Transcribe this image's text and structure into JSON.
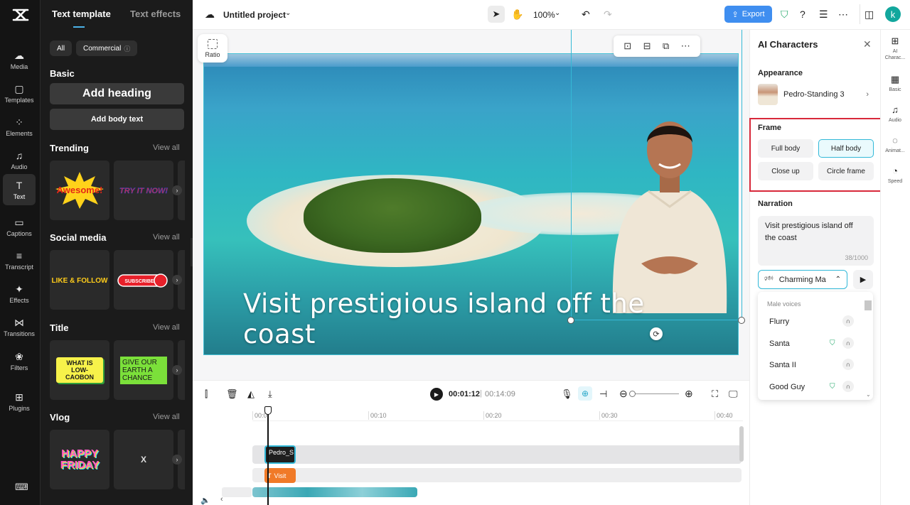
{
  "left_rail": {
    "logo": "CapCut",
    "items": [
      {
        "label": "Media",
        "icon": "media-icon",
        "glyph": "☁"
      },
      {
        "label": "Templates",
        "icon": "templates-icon",
        "glyph": "▢"
      },
      {
        "label": "Elements",
        "icon": "elements-icon",
        "glyph": "⁘"
      },
      {
        "label": "Audio",
        "icon": "audio-icon",
        "glyph": "♫"
      },
      {
        "label": "Text",
        "icon": "text-icon",
        "glyph": "T"
      },
      {
        "label": "Captions",
        "icon": "captions-icon",
        "glyph": "▭"
      },
      {
        "label": "Transcript",
        "icon": "transcript-icon",
        "glyph": "≡"
      },
      {
        "label": "Effects",
        "icon": "effects-icon",
        "glyph": "✦"
      },
      {
        "label": "Transitions",
        "icon": "transitions-icon",
        "glyph": "⋈"
      },
      {
        "label": "Filters",
        "icon": "filters-icon",
        "glyph": "❀"
      },
      {
        "label": "Plugins",
        "icon": "plugins-icon",
        "glyph": "⊞"
      }
    ],
    "active": "Text",
    "bottom_icon": "keyboard-icon"
  },
  "text_panel": {
    "tabs": [
      "Text template",
      "Text effects"
    ],
    "active_tab": "Text template",
    "filters": {
      "all": "All",
      "commercial": "Commercial"
    },
    "basic": {
      "title": "Basic",
      "add_heading": "Add heading",
      "add_body": "Add body text"
    },
    "view_all": "View all",
    "sections": [
      {
        "title": "Trending",
        "thumbs": [
          "Awesome!",
          "TRY IT NOW!"
        ]
      },
      {
        "title": "Social media",
        "thumbs": [
          "LIKE & FOLLOW",
          "SUBSCRIBE"
        ]
      },
      {
        "title": "Title",
        "thumbs": [
          "WHAT IS LOW-CAOBON",
          "GIVE OUR EARTH A CHANCE"
        ]
      },
      {
        "title": "Vlog",
        "thumbs": [
          "HAPPY FRIDAY",
          "X"
        ]
      }
    ]
  },
  "topbar": {
    "project_name": "Untitled project",
    "zoom": "100%",
    "export": "Export",
    "avatar_letter": "k"
  },
  "canvas": {
    "ratio_label": "Ratio",
    "overlay_text": "Visit prestigious island off the coast"
  },
  "right_panel": {
    "title": "AI Characters",
    "appearance_label": "Appearance",
    "character_name": "Pedro-Standing 3",
    "frame_label": "Frame",
    "frame_options": [
      "Full body",
      "Half body",
      "Close up",
      "Circle frame"
    ],
    "frame_selected": "Half body",
    "narration_label": "Narration",
    "narration_text": "Visit prestigious island off the coast",
    "char_count": "38/1000",
    "voice_selected": "Charming Ma",
    "voice_group": "Male voices",
    "voices": [
      {
        "name": "Flurry",
        "premium": false
      },
      {
        "name": "Santa",
        "premium": true
      },
      {
        "name": "Santa II",
        "premium": false
      },
      {
        "name": "Good Guy",
        "premium": true
      }
    ]
  },
  "right_rail": [
    {
      "label": "AI Charac...",
      "icon": "ai-character-icon"
    },
    {
      "label": "Basic",
      "icon": "basic-icon"
    },
    {
      "label": "Audio",
      "icon": "audio-icon"
    },
    {
      "label": "Animat...",
      "icon": "animation-icon"
    },
    {
      "label": "Speed",
      "icon": "speed-icon"
    }
  ],
  "timeline": {
    "current_time": "00:01:12",
    "total_time": "00:14:09",
    "ticks": [
      "00:0",
      "00:10",
      "00:20",
      "00:30",
      "00:40"
    ],
    "clip_character": "Pedro_S",
    "clip_text": "Visit"
  },
  "colors": {
    "accent": "#31b8d8",
    "export": "#3f8ef0",
    "highlight": "#d8283a",
    "text_clip": "#f07a28"
  }
}
